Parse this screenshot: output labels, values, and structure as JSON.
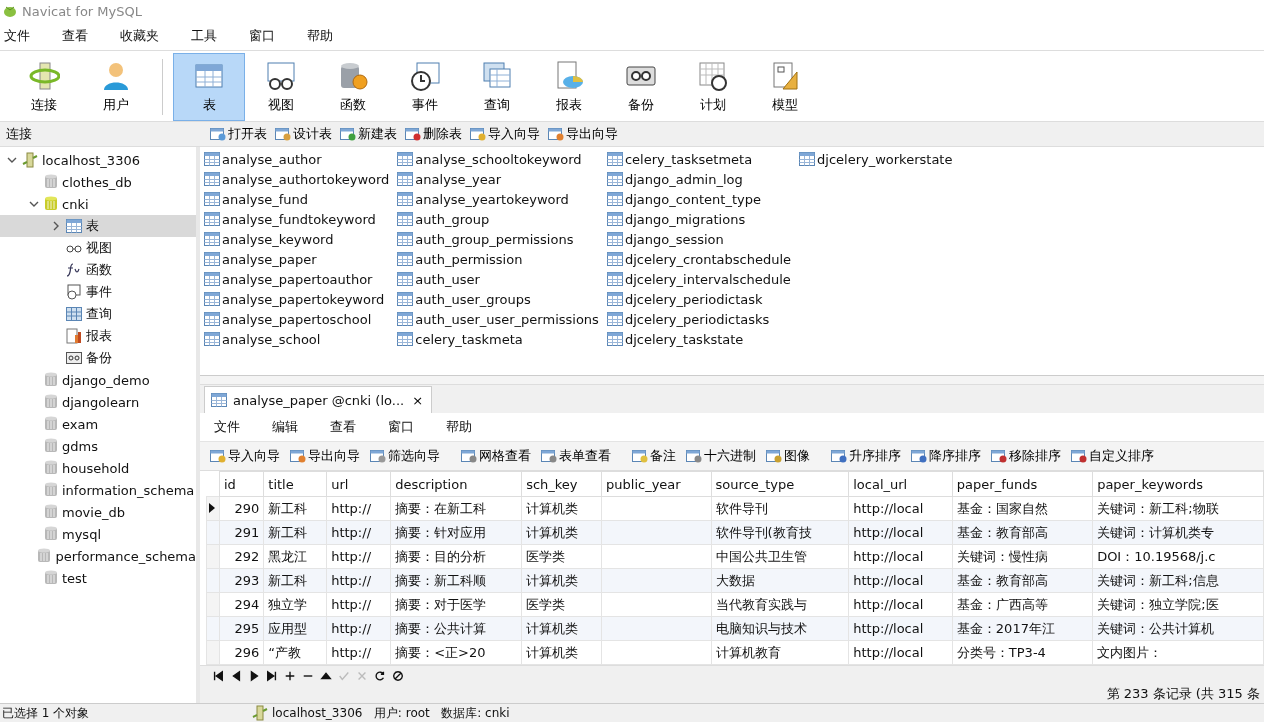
{
  "window": {
    "title": "Navicat for MySQL"
  },
  "menu": [
    "文件",
    "查看",
    "收藏夹",
    "工具",
    "窗口",
    "帮助"
  ],
  "toolbar": [
    {
      "label": "连接",
      "selected": false
    },
    {
      "label": "用户",
      "selected": false
    },
    {
      "label": "表",
      "selected": true
    },
    {
      "label": "视图",
      "selected": false
    },
    {
      "label": "函数",
      "selected": false
    },
    {
      "label": "事件",
      "selected": false
    },
    {
      "label": "查询",
      "selected": false
    },
    {
      "label": "报表",
      "selected": false
    },
    {
      "label": "备份",
      "selected": false
    },
    {
      "label": "计划",
      "selected": false
    },
    {
      "label": "模型",
      "selected": false
    }
  ],
  "sidebar": {
    "title": "连接",
    "items": [
      {
        "label": "localhost_3306",
        "kind": "server",
        "expanded": true,
        "selected": false,
        "children": [
          {
            "label": "clothes_db",
            "kind": "db",
            "open": false,
            "selected": false
          },
          {
            "label": "cnki",
            "kind": "db",
            "open": true,
            "expanded": true,
            "selected": false,
            "children": [
              {
                "label": "表",
                "kind": "tables",
                "expanded": false,
                "selected": true
              },
              {
                "label": "视图",
                "kind": "views",
                "selected": false
              },
              {
                "label": "函数",
                "kind": "functions",
                "selected": false
              },
              {
                "label": "事件",
                "kind": "events",
                "selected": false
              },
              {
                "label": "查询",
                "kind": "queries",
                "selected": false
              },
              {
                "label": "报表",
                "kind": "reports",
                "selected": false
              },
              {
                "label": "备份",
                "kind": "backups",
                "selected": false
              }
            ]
          },
          {
            "label": "django_demo",
            "kind": "db",
            "open": false,
            "selected": false
          },
          {
            "label": "djangolearn",
            "kind": "db",
            "open": false,
            "selected": false
          },
          {
            "label": "exam",
            "kind": "db",
            "open": false,
            "selected": false
          },
          {
            "label": "gdms",
            "kind": "db",
            "open": false,
            "selected": false
          },
          {
            "label": "household",
            "kind": "db",
            "open": false,
            "selected": false
          },
          {
            "label": "information_schema",
            "kind": "db",
            "open": false,
            "selected": false
          },
          {
            "label": "movie_db",
            "kind": "db",
            "open": false,
            "selected": false
          },
          {
            "label": "mysql",
            "kind": "db",
            "open": false,
            "selected": false
          },
          {
            "label": "performance_schema",
            "kind": "db",
            "open": false,
            "selected": false
          },
          {
            "label": "test",
            "kind": "db",
            "open": false,
            "selected": false
          }
        ]
      }
    ]
  },
  "object_toolbar": [
    "打开表",
    "设计表",
    "新建表",
    "删除表",
    "导入向导",
    "导出向导"
  ],
  "tables": [
    "analyse_author",
    "analyse_authortokeyword",
    "analyse_fund",
    "analyse_fundtokeyword",
    "analyse_keyword",
    "analyse_paper",
    "analyse_papertoauthor",
    "analyse_papertokeyword",
    "analyse_papertoschool",
    "analyse_school",
    "analyse_schooltokeyword",
    "analyse_year",
    "analyse_yeartokeyword",
    "auth_group",
    "auth_group_permissions",
    "auth_permission",
    "auth_user",
    "auth_user_groups",
    "auth_user_user_permissions",
    "celery_taskmeta",
    "celery_tasksetmeta",
    "django_admin_log",
    "django_content_type",
    "django_migrations",
    "django_session",
    "djcelery_crontabschedule",
    "djcelery_intervalschedule",
    "djcelery_periodictask",
    "djcelery_periodictasks",
    "djcelery_taskstate",
    "djcelery_workerstate"
  ],
  "tab": {
    "title": "analyse_paper @cnki (lo...",
    "close": "×"
  },
  "tab_menu": [
    "文件",
    "编辑",
    "查看",
    "窗口",
    "帮助"
  ],
  "tab_toolbar": [
    "导入向导",
    "导出向导",
    "筛选向导",
    "网格查看",
    "表单查看",
    "备注",
    "十六进制",
    "图像",
    "升序排序",
    "降序排序",
    "移除排序",
    "自定义排序"
  ],
  "table": {
    "columns": [
      "id",
      "title",
      "url",
      "description",
      "sch_key",
      "public_year",
      "source_type",
      "local_url",
      "paper_funds",
      "paper_keywords"
    ],
    "rows": [
      {
        "selected": true,
        "cells": [
          "290",
          "新工科",
          "http://",
          "摘要：在新工科",
          "计算机类",
          "",
          "软件导刊",
          "http://local",
          "基金：国家自然",
          "关键词：新工科;物联"
        ]
      },
      {
        "selected": false,
        "cells": [
          "291",
          "新工科",
          "http://",
          "摘要：针对应用",
          "计算机类",
          "",
          "软件导刊(教育技",
          "http://local",
          "基金：教育部高",
          "关键词：计算机类专"
        ]
      },
      {
        "selected": false,
        "cells": [
          "292",
          "黑龙江",
          "http://",
          "摘要：目的分析",
          "医学类",
          "",
          "中国公共卫生管",
          "http://local",
          "关键词：慢性病",
          "DOI：10.19568/j.c"
        ]
      },
      {
        "selected": false,
        "cells": [
          "293",
          "新工科",
          "http://",
          "摘要：新工科顺",
          "计算机类",
          "",
          "大数据",
          "http://local",
          "基金：教育部高",
          "关键词：新工科;信息"
        ]
      },
      {
        "selected": false,
        "cells": [
          "294",
          "独立学",
          "http://",
          "摘要：对于医学",
          "医学类",
          "",
          "当代教育实践与",
          "http://local",
          "基金：广西高等",
          "关键词：独立学院;医"
        ]
      },
      {
        "selected": false,
        "cells": [
          "295",
          "应用型",
          "http://",
          "摘要：公共计算",
          "计算机类",
          "",
          "电脑知识与技术",
          "http://local",
          "基金：2017年江",
          "关键词：公共计算机"
        ]
      },
      {
        "selected": false,
        "cells": [
          "296",
          "“产教",
          "http://",
          "摘要：<正>20",
          "计算机类",
          "",
          "计算机教育",
          "http://local",
          "分类号：TP3-4",
          "文内图片："
        ]
      }
    ]
  },
  "record_status": "第 233 条记录 (共 315 条",
  "status_bar": {
    "selection": "已选择 1 个对象",
    "connection": "localhost_3306   用户: root   数据库: cnki"
  }
}
